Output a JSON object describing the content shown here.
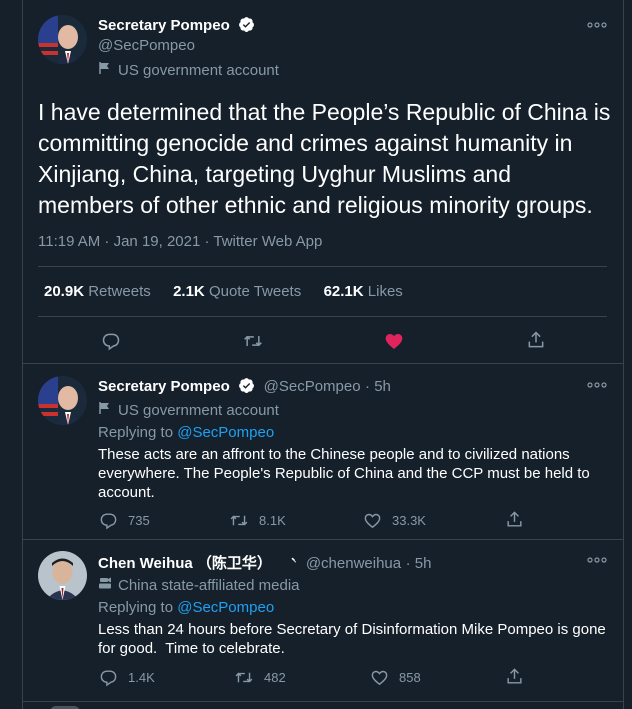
{
  "main_tweet": {
    "name": "Secretary Pompeo",
    "handle": "@SecPompeo",
    "label": "US government account",
    "text": "I have determined that the People’s Republic of China is committing genocide and crimes against humanity in Xinjiang, China, targeting Uyghur Muslims and members of other ethnic and religious minority groups.",
    "meta": "11:19 AM · Jan 19, 2021 · Twitter Web App",
    "retweets_count": "20.9K",
    "retweets_label": "Retweets",
    "quotes_count": "2.1K",
    "quotes_label": "Quote Tweets",
    "likes_count": "62.1K",
    "likes_label": "Likes",
    "liked_color": "#e0245e"
  },
  "reply1": {
    "name": "Secretary Pompeo",
    "handle": "@SecPompeo",
    "time": "· 5h",
    "label": "US government account",
    "replying_to_label": "Replying to",
    "replying_to_handle": "@SecPompeo",
    "text": "These acts are an affront to the Chinese people and to civilized nations everywhere. The People's Republic of China and the CCP must be held to account.",
    "reply_count": "735",
    "retweet_count": "8.1K",
    "like_count": "33.3K"
  },
  "reply2": {
    "name": "Chen Weihua （陈卫华）",
    "handle": "@chenweihua",
    "time": "· 5h",
    "label": "China state-affiliated media",
    "replying_to_label": "Replying to",
    "replying_to_handle": "@SecPompeo",
    "text": "Less than 24 hours before Secretary of Disinformation Mike Pompeo is gone for good.  Time to celebrate.",
    "reply_count": "1.4K",
    "retweet_count": "482",
    "like_count": "858"
  },
  "colors": {
    "background": "#15202b",
    "border": "#38444d",
    "muted": "#8899a6",
    "link": "#1da1f2"
  }
}
